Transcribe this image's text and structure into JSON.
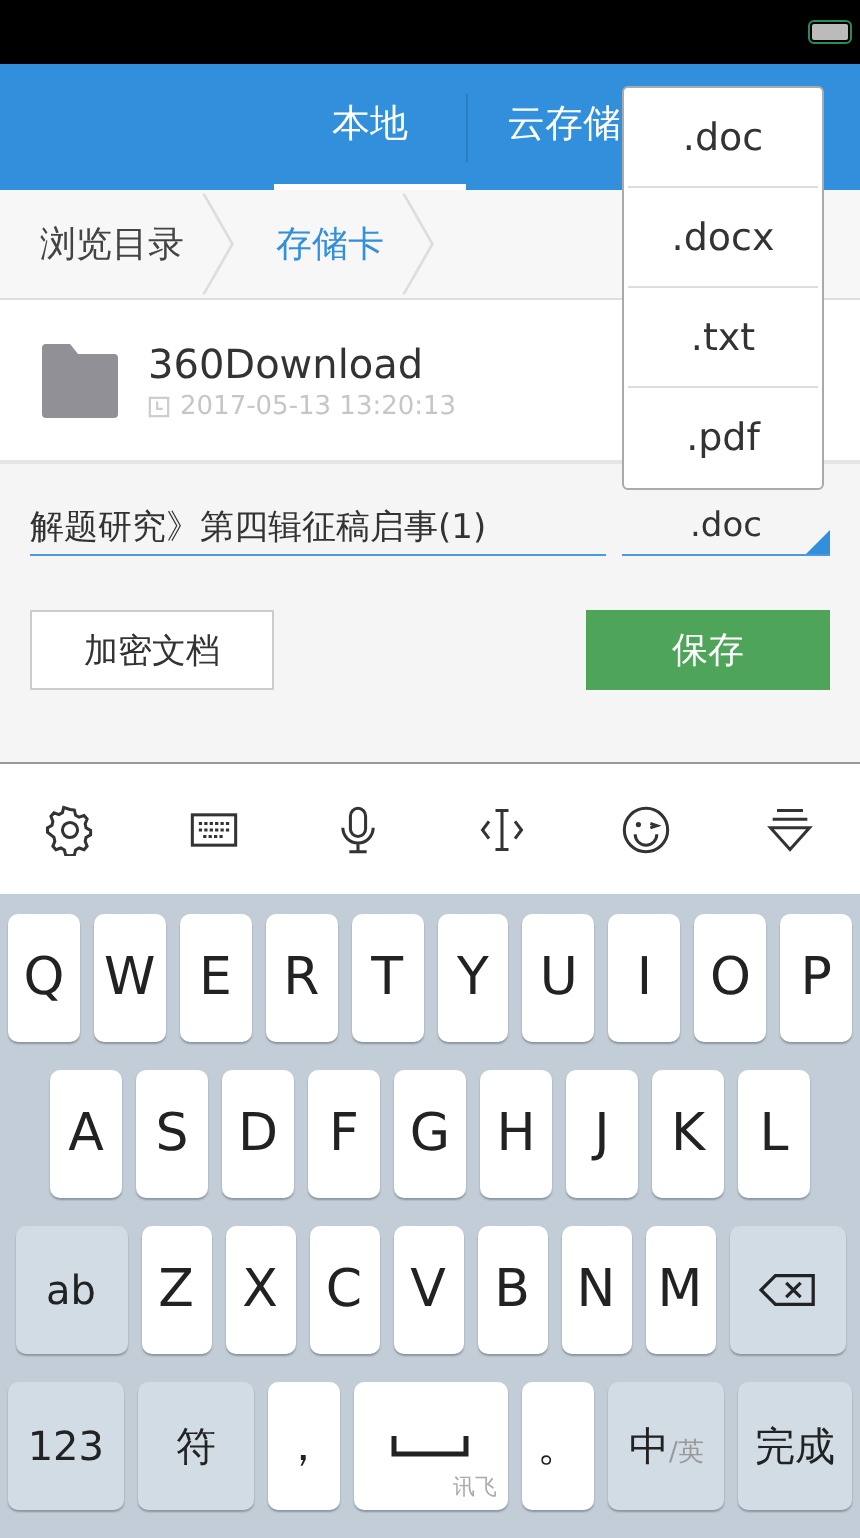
{
  "tabs": [
    {
      "label": "本地",
      "selected": true
    },
    {
      "label": "云存储",
      "selected": false
    }
  ],
  "breadcrumb": [
    {
      "label": "浏览目录",
      "selected": false
    },
    {
      "label": "存储卡",
      "selected": true
    }
  ],
  "files": [
    {
      "name": "360Download",
      "modified": "2017-05-13 13:20:13"
    }
  ],
  "save_panel": {
    "filename": "解题研究》第四辑征稿启事(1)",
    "format": ".doc",
    "encrypt_button": "加密文档",
    "save_button": "保存"
  },
  "format_menu": {
    "options": [
      ".doc",
      ".docx",
      ".txt",
      ".pdf"
    ]
  },
  "keyboard": {
    "rows": [
      {
        "keys": [
          {
            "label": "Q",
            "kind": "letter"
          },
          {
            "label": "W",
            "kind": "letter"
          },
          {
            "label": "E",
            "kind": "letter"
          },
          {
            "label": "R",
            "kind": "letter"
          },
          {
            "label": "T",
            "kind": "letter"
          },
          {
            "label": "Y",
            "kind": "letter"
          },
          {
            "label": "U",
            "kind": "letter"
          },
          {
            "label": "I",
            "kind": "letter"
          },
          {
            "label": "O",
            "kind": "letter"
          },
          {
            "label": "P",
            "kind": "letter"
          }
        ]
      },
      {
        "keys": [
          {
            "label": "A",
            "kind": "letter"
          },
          {
            "label": "S",
            "kind": "letter"
          },
          {
            "label": "D",
            "kind": "letter"
          },
          {
            "label": "F",
            "kind": "letter"
          },
          {
            "label": "G",
            "kind": "letter"
          },
          {
            "label": "H",
            "kind": "letter"
          },
          {
            "label": "J",
            "kind": "letter"
          },
          {
            "label": "K",
            "kind": "letter"
          },
          {
            "label": "L",
            "kind": "letter"
          }
        ]
      },
      {
        "keys": [
          {
            "label": "ab",
            "kind": "function"
          },
          {
            "label": "Z",
            "kind": "letter"
          },
          {
            "label": "X",
            "kind": "letter"
          },
          {
            "label": "C",
            "kind": "letter"
          },
          {
            "label": "V",
            "kind": "letter"
          },
          {
            "label": "B",
            "kind": "letter"
          },
          {
            "label": "N",
            "kind": "letter"
          },
          {
            "label": "M",
            "kind": "letter"
          },
          {
            "kind": "backspace"
          }
        ]
      },
      {
        "keys": [
          {
            "label": "123",
            "kind": "function"
          },
          {
            "label": "符",
            "kind": "function"
          },
          {
            "label": "，",
            "kind": "punct"
          },
          {
            "kind": "space",
            "sub": "讯飞"
          },
          {
            "label": "。",
            "kind": "punct"
          },
          {
            "label": "中",
            "kind": "function",
            "sub": "/英"
          },
          {
            "label": "完成",
            "kind": "function"
          }
        ]
      }
    ]
  }
}
